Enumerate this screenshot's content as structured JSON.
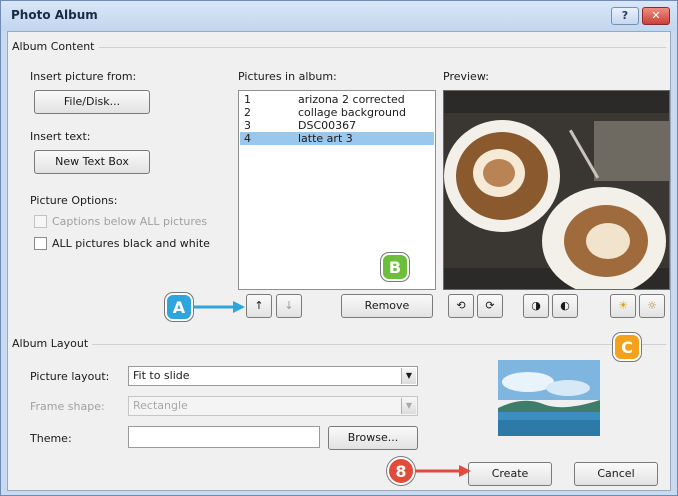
{
  "window": {
    "title": "Photo Album"
  },
  "album_content": {
    "group_label": "Album Content",
    "insert_picture_label": "Insert picture from:",
    "file_disk_button": "File/Disk...",
    "insert_text_label": "Insert text:",
    "new_text_box_button": "New Text Box",
    "picture_options_label": "Picture Options:",
    "captions_option": "Captions below ALL pictures",
    "bw_option": "ALL pictures black and white",
    "pictures_in_album_label": "Pictures in album:",
    "pictures": [
      {
        "num": "1",
        "name": "arizona 2 corrected",
        "selected": false
      },
      {
        "num": "2",
        "name": "collage background",
        "selected": false
      },
      {
        "num": "3",
        "name": "DSC00367",
        "selected": false
      },
      {
        "num": "4",
        "name": "latte art 3",
        "selected": true
      }
    ],
    "preview_label": "Preview:",
    "move_up_button": "↑",
    "move_down_button": "↓",
    "remove_button": "Remove"
  },
  "album_layout": {
    "group_label": "Album Layout",
    "picture_layout_label": "Picture layout:",
    "picture_layout_value": "Fit to slide",
    "frame_shape_label": "Frame shape:",
    "frame_shape_value": "Rectangle",
    "theme_label": "Theme:",
    "theme_value": "",
    "browse_button": "Browse...",
    "create_button": "Create",
    "cancel_button": "Cancel"
  },
  "callouts": {
    "a": "A",
    "b": "B",
    "c": "C",
    "step": "8"
  },
  "colors": {
    "badge_blue": "#2fa5dd",
    "badge_green": "#6cbf3a",
    "badge_orange": "#f4a11b",
    "badge_red": "#e14b3a",
    "list_selection": "#99c7ee"
  }
}
